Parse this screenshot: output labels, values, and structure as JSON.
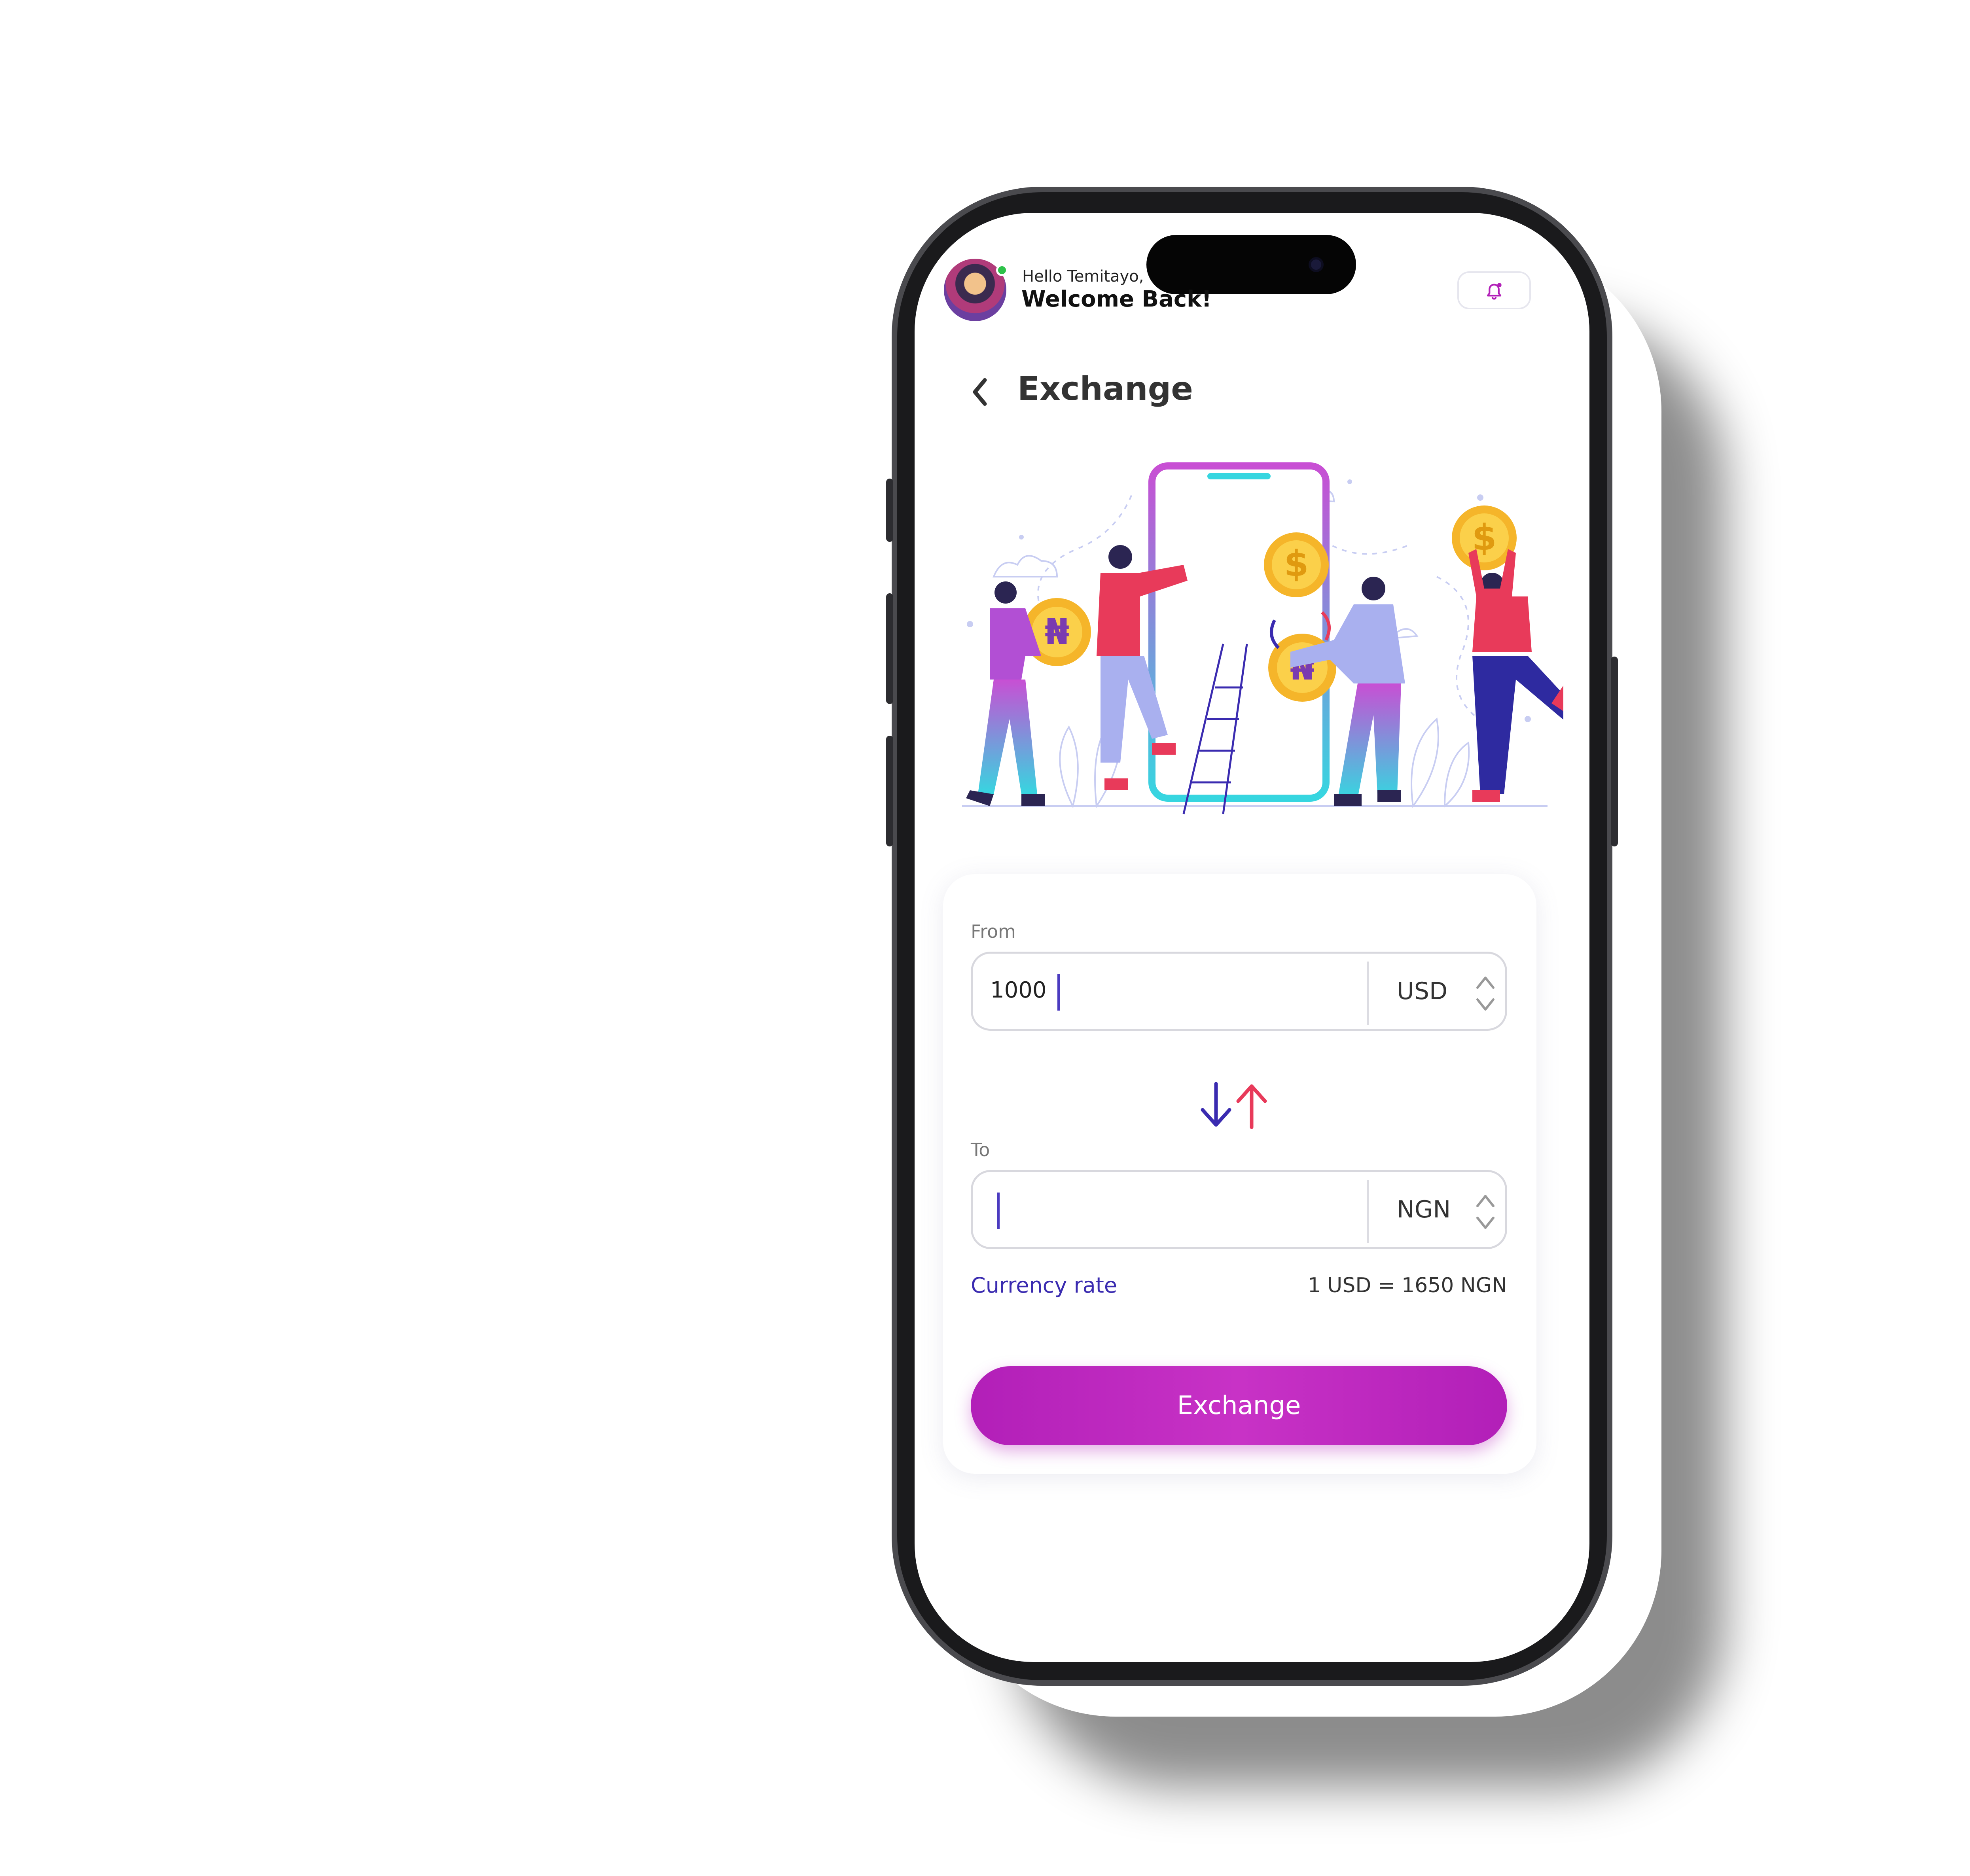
{
  "header": {
    "greeting": "Hello Temitayo,",
    "welcome": "Welcome Back!",
    "avatar_icon": "user-avatar",
    "bell_icon": "bell-icon"
  },
  "page": {
    "title": "Exchange",
    "back_icon": "chevron-left-icon"
  },
  "form": {
    "from_label": "From",
    "from_value": "1000",
    "from_currency": "USD",
    "to_label": "To",
    "to_value": "",
    "to_currency": "NGN",
    "rate_label": "Currency rate",
    "rate_value": "1 USD = 1650 NGN",
    "submit_label": "Exchange"
  },
  "colors": {
    "accent": "#b21fb8",
    "rate_label": "#3a2bb0",
    "swap_down": "#3a2bb0",
    "swap_up": "#e83a5a",
    "coin": "#f5b52a"
  }
}
